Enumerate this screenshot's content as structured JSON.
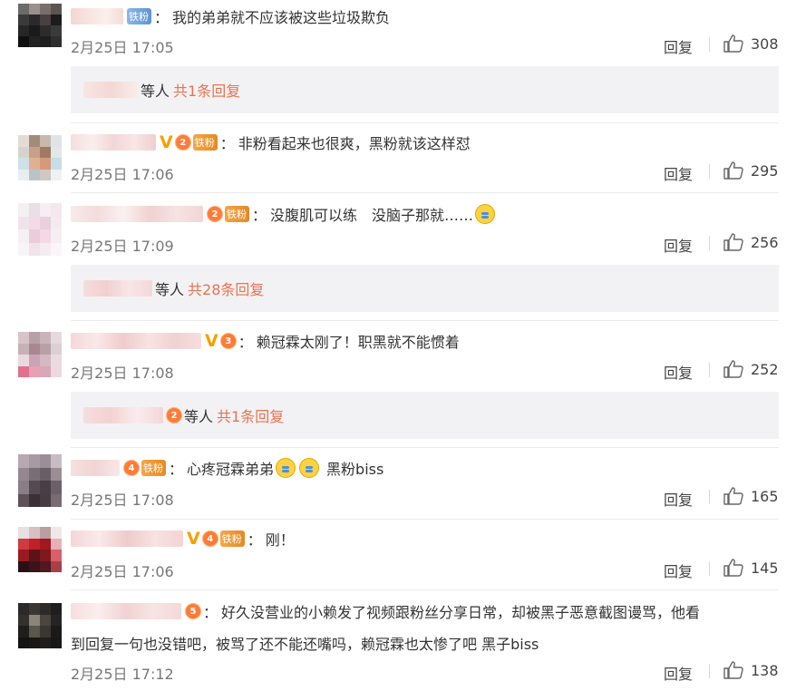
{
  "colors": {
    "link": "#eb7350",
    "time": "#777777",
    "reply_bg": "#f2f2f5",
    "vip": "#f6a000"
  },
  "reply_label": "回复",
  "people_suffix": "等人",
  "comments": [
    {
      "badge_text": "铁粉",
      "text": "我的弟弟就不应该被这些垃圾欺负",
      "time": "2月25日 17:05",
      "likes": "308",
      "reply_more": "共1条回复",
      "avatar": [
        "#6b6b6b",
        "#9a8f8a",
        "#7a6f6a",
        "#5a5552",
        "#3a3a3a",
        "#2a2a2a",
        "#4a4040",
        "#1c1c1c",
        "#262626",
        "#1a1a1a",
        "#2c2c2c",
        "#3a3a3a",
        "#101010",
        "#222222",
        "#1e1e1e",
        "#2e2e2e"
      ]
    },
    {
      "badge_text": "铁粉",
      "crown_level": "2",
      "text": "非粉看起来也很爽，黑粉就该这样怼",
      "time": "2月25日 17:06",
      "likes": "295",
      "avatar": [
        "#e3dcd6",
        "#a38b7a",
        "#c9b8ac",
        "#dfe4e8",
        "#d8d2cc",
        "#c8a08a",
        "#a07a64",
        "#e2e7ea",
        "#cfe0e6",
        "#e0b092",
        "#d49a7a",
        "#c7dde4",
        "#e8eef0",
        "#b8c4c8",
        "#d0c8c0",
        "#eef2f4"
      ]
    },
    {
      "badge_text": "铁粉",
      "crown_level": "2",
      "text": "没腹肌可以练　没脑子那就……",
      "time": "2月25日 17:09",
      "likes": "256",
      "reply_more": "共28条回复",
      "avatar": [
        "#f4f0f2",
        "#eadfe4",
        "#f6eef2",
        "#f2e8ee",
        "#efe4ea",
        "#f2dbe6",
        "#e8d0dc",
        "#f4eaf0",
        "#f6f0f4",
        "#eccbdb",
        "#f3d8e5",
        "#f6eef3",
        "#f8f4f6",
        "#f0e4ea",
        "#f4ecf0",
        "#faf6f8"
      ]
    },
    {
      "crown_level": "3",
      "text": "赖冠霖太刚了！职黑就不能惯着",
      "time": "2月25日 17:08",
      "likes": "252",
      "reply_more": "共1条回复",
      "reply_crown": "2",
      "avatar": [
        "#d8c4c8",
        "#b8a0a8",
        "#cab4bb",
        "#e6dade",
        "#c8b0b8",
        "#a88890",
        "#b8a0a6",
        "#dcd0d4",
        "#ead9df",
        "#c8a4b4",
        "#d4b8c2",
        "#e8dce0",
        "#e0708e",
        "#e8a0b4",
        "#d8a8b8",
        "#ecd8de"
      ]
    },
    {
      "badge_text": "铁粉",
      "crown_level": "4",
      "text": "心疼冠霖弟弟",
      "text_after": "黑粉biss",
      "time": "2月25日 17:08",
      "likes": "165",
      "avatar": [
        "#b8a8b0",
        "#a89aa2",
        "#9c8e96",
        "#c8bcc2",
        "#948890",
        "#7a6e76",
        "#6a5e66",
        "#9a8e94",
        "#8a7e86",
        "#564a52",
        "#4a3e46",
        "#6c6068",
        "#5e5258",
        "#3a3036",
        "#463c42",
        "#786c72"
      ]
    },
    {
      "badge_text": "铁粉",
      "badge_blue": true,
      "crown_level": "4",
      "text": "刚！",
      "time": "2月25日 17:06",
      "likes": "145",
      "avatar": [
        "#e8e0e0",
        "#d8c0c0",
        "#b8a0a0",
        "#f0e8e8",
        "#d03a40",
        "#c02028",
        "#a01820",
        "#e8b0b4",
        "#9a1a20",
        "#5a1418",
        "#801820",
        "#d86068",
        "#2a1014",
        "#3a1418",
        "#501820",
        "#a84048"
      ]
    },
    {
      "crown_level": "5",
      "text": "好久没营业的小赖发了视频跟粉丝分享日常，却被黑子恶意截图谩骂，他看",
      "text2": "到回复一句也没错吧，被骂了还不能还嘴吗，赖冠霖也太惨了吧 黑子biss",
      "time": "2月25日 17:12",
      "likes": "138",
      "avatar": [
        "#2a2a2a",
        "#3a3632",
        "#2e2a28",
        "#1e1e1e",
        "#34302c",
        "#8a847a",
        "#4a463e",
        "#262422",
        "#201e1c",
        "#5a5650",
        "#3a3632",
        "#1c1a18",
        "#141414",
        "#1a1816",
        "#201e1c",
        "#181818"
      ]
    }
  ]
}
